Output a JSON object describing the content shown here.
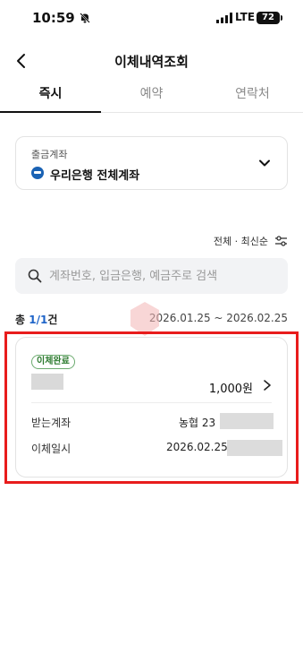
{
  "status_bar": {
    "time": "10:59",
    "network": "LTE",
    "battery": "72"
  },
  "header": {
    "title": "이체내역조회"
  },
  "tabs": [
    {
      "label": "즉시",
      "active": true
    },
    {
      "label": "예약",
      "active": false
    },
    {
      "label": "연락처",
      "active": false
    }
  ],
  "account": {
    "label": "출금계좌",
    "value": "우리은행 전체계좌"
  },
  "sort": {
    "label": "전체 · 최신순"
  },
  "search": {
    "placeholder": "계좌번호, 입금은행, 예금주로 검색"
  },
  "summary": {
    "prefix": "총 ",
    "count": "1/1",
    "suffix": "건",
    "range": "2026.01.25 ~ 2026.02.25"
  },
  "transaction": {
    "status": "이체완료",
    "amount": "1,000원",
    "receive_label": "받는계좌",
    "receive_value": "농협 23",
    "date_label": "이체일시",
    "date_value": "2026.02.25"
  },
  "colors": {
    "accent": "#1e64c8",
    "highlight": "#e81c1c",
    "badge": "#2c7a2e"
  }
}
